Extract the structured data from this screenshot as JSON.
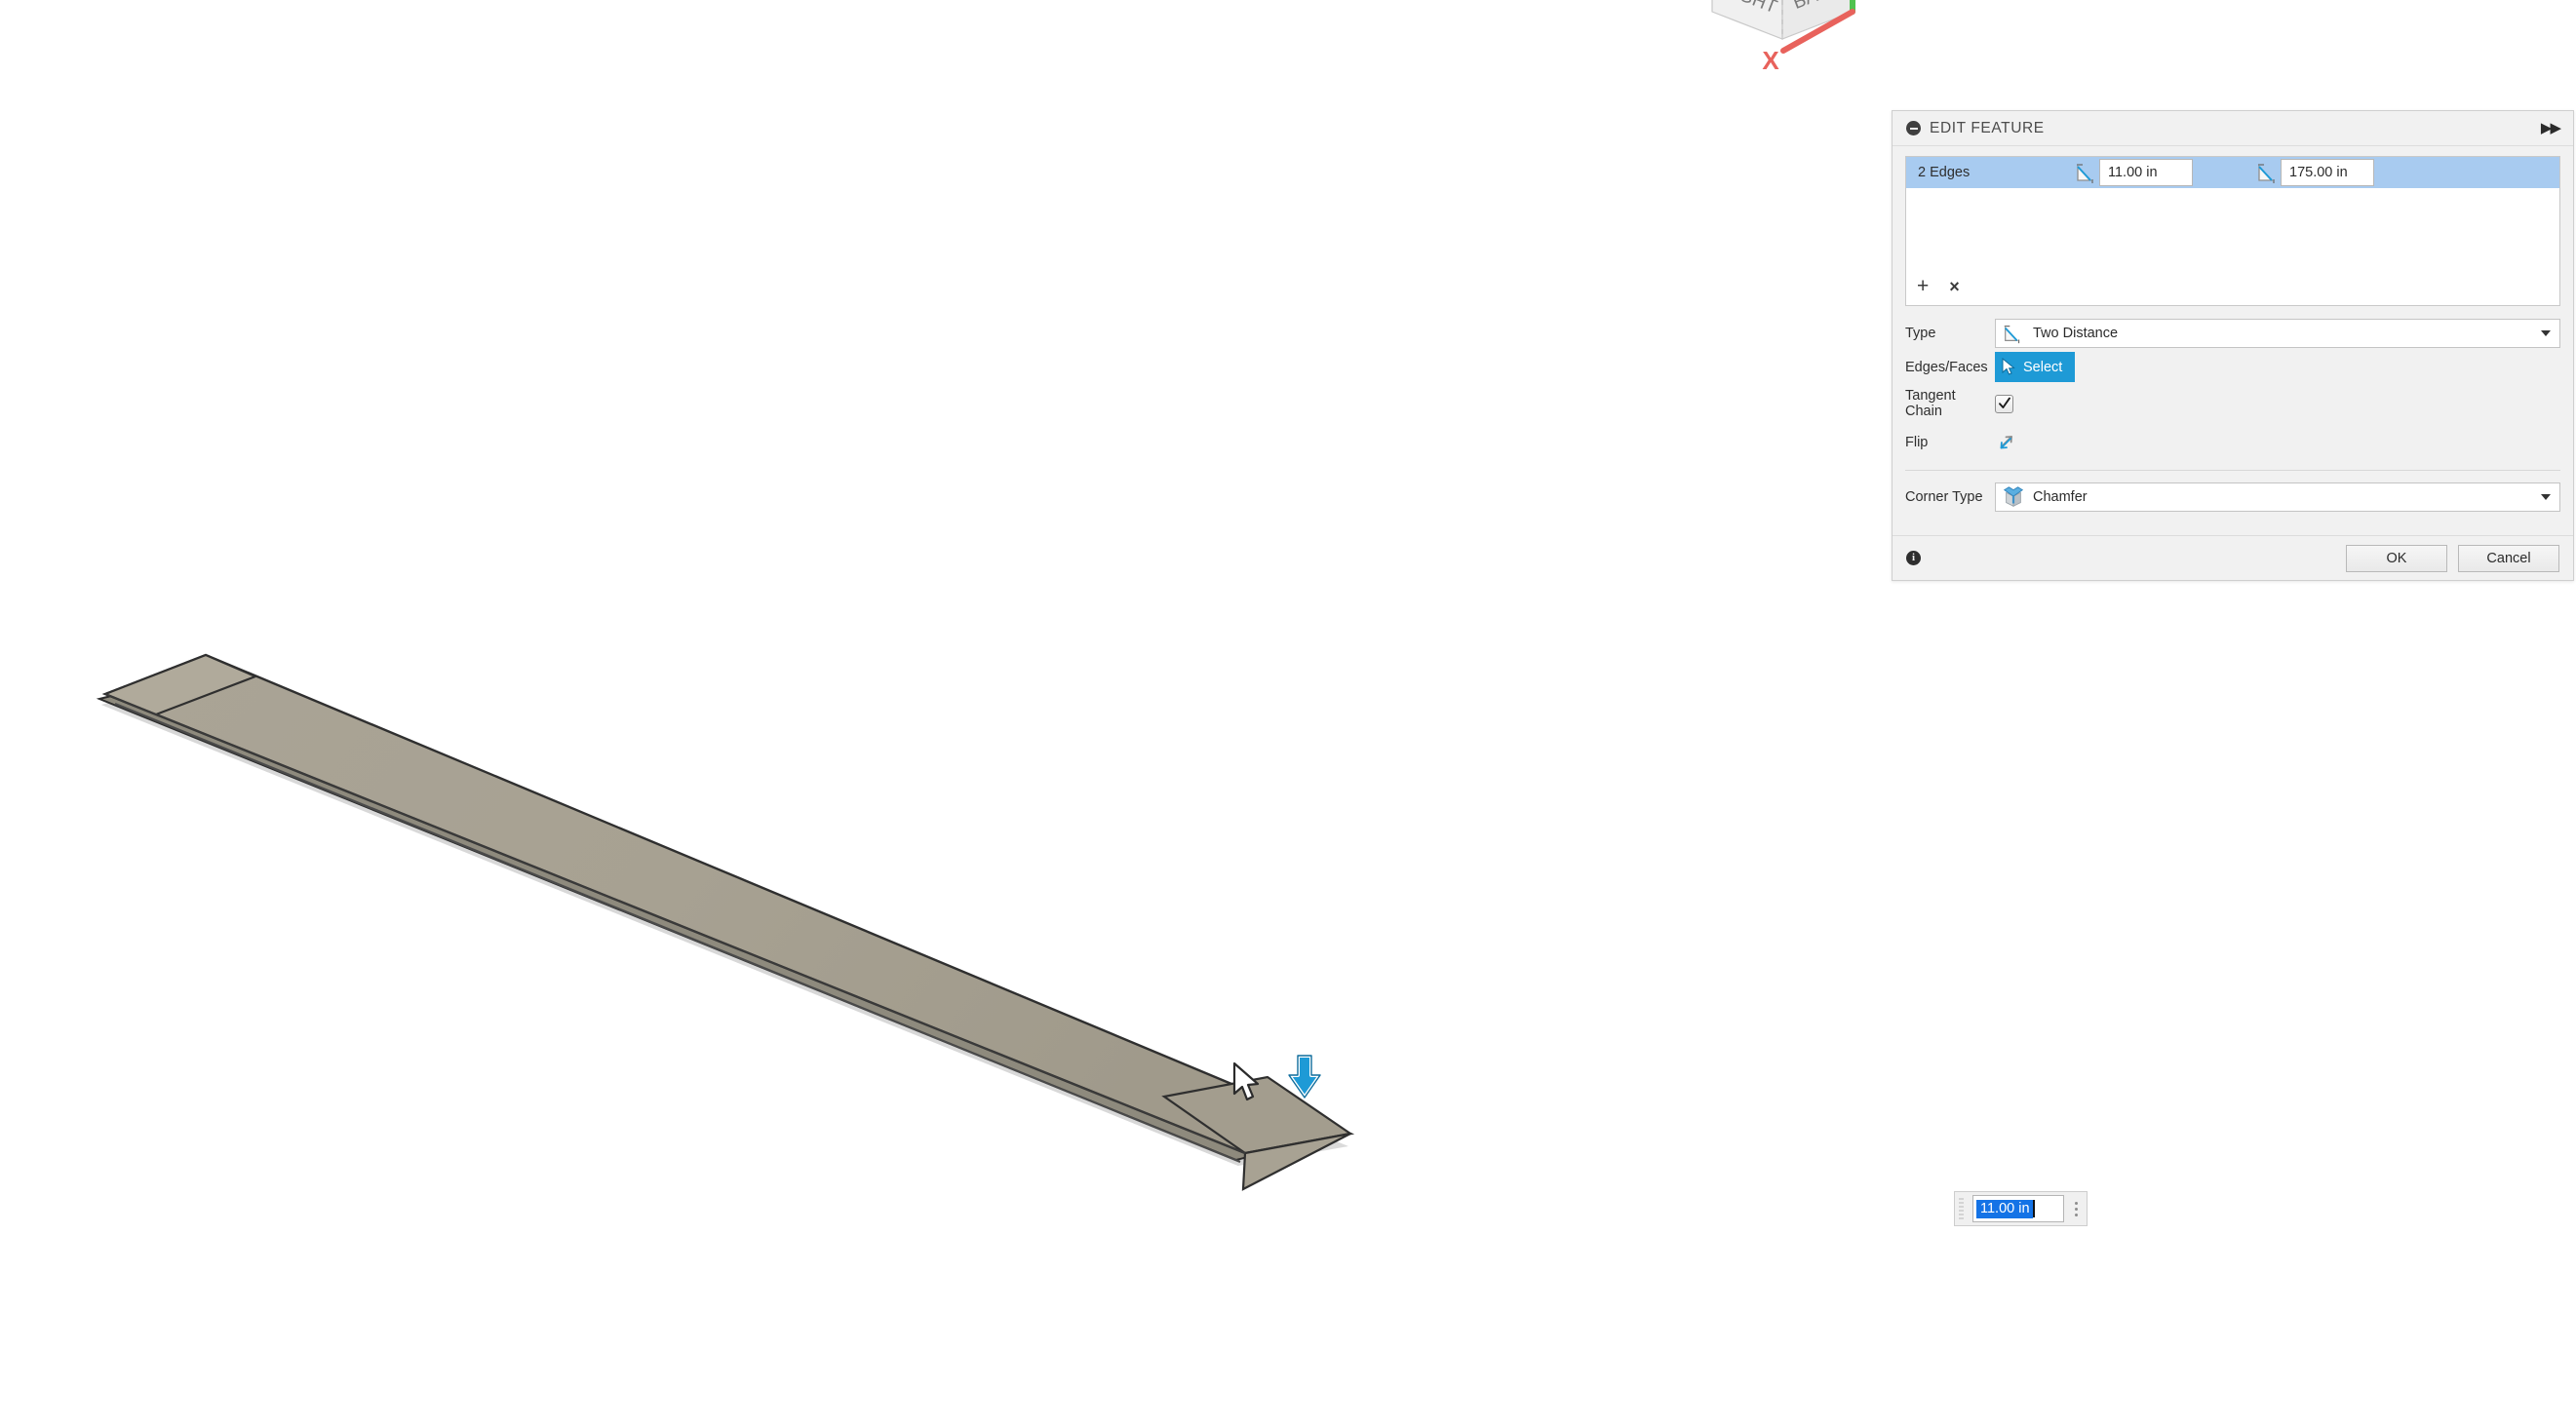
{
  "app": {
    "background_color": "#ffffff",
    "accent_color": "#1e9ad6",
    "selection_color": "#a8cbf0",
    "model_top_color": "#a8a293",
    "model_shadow_color": "#d2d2d2"
  },
  "viewcube": {
    "face_right_label": "RIGHT",
    "face_back_label": "BACK",
    "axis_x_label": "X",
    "axis_x_color": "#e8625c",
    "axis_y_color": "#4fc24f"
  },
  "panel": {
    "header": {
      "title": "EDIT FEATURE",
      "collapse_icon": "minus-circle-icon",
      "expand_icon": "double-chevron-right-icon"
    },
    "selection_list": {
      "rows": [
        {
          "label": "2 Edges",
          "distance1_icon": "chamfer-distance-icon",
          "distance1": "11.00 in",
          "distance2_icon": "chamfer-distance-icon",
          "distance2": "175.00 in",
          "selected": true
        }
      ],
      "add_label": "+",
      "remove_label": "×"
    },
    "fields": [
      {
        "label": "Type",
        "control": "combo",
        "icon": "chamfer-two-distance-icon",
        "value": "Two Distance"
      },
      {
        "label": "Edges/Faces",
        "control": "button",
        "icon": "cursor-arrow-icon",
        "value": "Select"
      },
      {
        "label": "Tangent Chain",
        "control": "checkbox",
        "value": "checked"
      },
      {
        "label": "Flip",
        "control": "icon-button",
        "icon": "flip-arrows-icon",
        "value": ""
      }
    ],
    "corner_type": {
      "label": "Corner Type",
      "icon": "corner-chamfer-icon",
      "value": "Chamfer"
    },
    "footer": {
      "info_icon": "info-icon",
      "info_label": "i",
      "ok_label": "OK",
      "cancel_label": "Cancel"
    }
  },
  "floating_input": {
    "grip_icon": "drag-grip-icon",
    "value": "11.00 in",
    "selected": true,
    "menu_icon": "kebab-menu-icon"
  },
  "viewport": {
    "cursor_icon": "mouse-cursor-icon",
    "manipulator_icon": "down-arrow-manipulator-icon",
    "manipulator_color": "#1e9ad6"
  }
}
